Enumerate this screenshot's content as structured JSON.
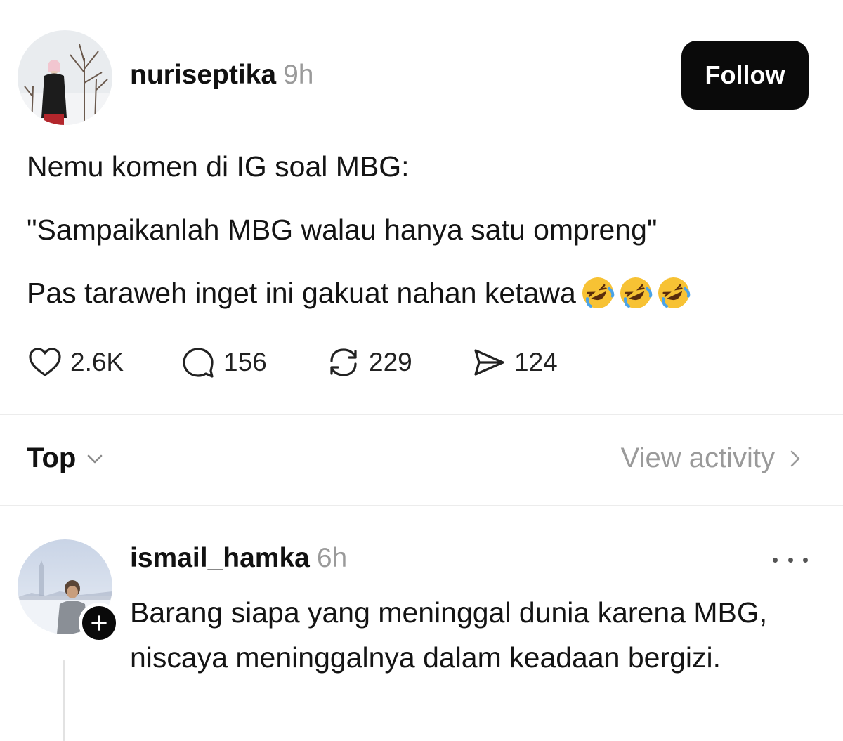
{
  "post": {
    "username": "nuriseptika",
    "time": "9h",
    "follow_label": "Follow",
    "lines": [
      "Nemu komen di IG soal MBG:",
      "\"Sampaikanlah MBG walau hanya satu ompreng\"",
      "Pas taraweh inget ini gakuat nahan ketawa"
    ],
    "emojis": [
      "rolling-on-floor-laughing-emoji",
      "rolling-on-floor-laughing-emoji",
      "rolling-on-floor-laughing-emoji"
    ],
    "actions": {
      "likes": "2.6K",
      "comments": "156",
      "reposts": "229",
      "shares": "124"
    }
  },
  "sort_bar": {
    "sort_label": "Top",
    "view_activity_label": "View activity"
  },
  "reply": {
    "username": "ismail_hamka",
    "time": "6h",
    "text": "Barang siapa yang meninggal dunia karena MBG, niscaya meninggalnya dalam keadaan bergizi."
  },
  "icons": {
    "like": "heart-icon",
    "comment": "comment-bubble-icon",
    "repost": "repost-icon",
    "share": "send-icon",
    "sort": "chevron-down-icon",
    "view_activity": "chevron-right-icon",
    "more": "more-horizontal-icon",
    "follow_badge": "plus-icon"
  },
  "colors": {
    "text": "#111111",
    "muted": "#9a9a9a",
    "button_bg": "#0a0a0a",
    "divider": "#ececec"
  }
}
